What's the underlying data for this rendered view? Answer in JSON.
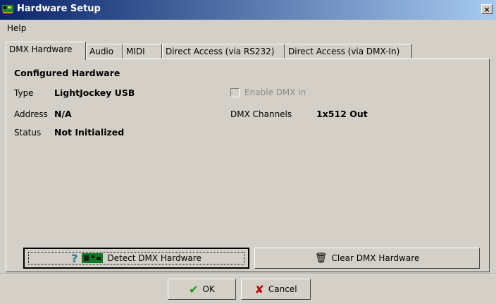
{
  "window": {
    "title": "Hardware Setup",
    "close_glyph": "×"
  },
  "menu": {
    "help": "Help"
  },
  "tabs": [
    {
      "label": "DMX Hardware",
      "active": true
    },
    {
      "label": "Audio"
    },
    {
      "label": "MIDI"
    },
    {
      "label": "Direct Access (via RS232)"
    },
    {
      "label": "Direct Access (via DMX-In)"
    }
  ],
  "configured": {
    "title": "Configured Hardware",
    "type_label": "Type",
    "type_value": "LightJockey USB",
    "address_label": "Address",
    "address_value": "N/A",
    "status_label": "Status",
    "status_value": "Not Initialized",
    "enable_dmx_label": "Enable DMX in",
    "enable_dmx_checked": false,
    "dmx_channels_label": "DMX Channels",
    "dmx_channels_value": "1x512 Out"
  },
  "buttons": {
    "detect": "Detect DMX Hardware",
    "clear": "Clear DMX Hardware",
    "ok": "OK",
    "cancel": "Cancel"
  },
  "icons": {
    "app": "hardware-card-icon",
    "detect_help": "question-icon",
    "detect_chip": "chip-icon",
    "clear": "trash-icon",
    "ok": "checkmark-icon",
    "cancel": "x-icon"
  },
  "colors": {
    "titlebar_start": "#0a246a",
    "titlebar_end": "#a6caf0",
    "face": "#d4d0c8",
    "disabled_text": "#8a8a8a",
    "ok_green": "#1a9a1a",
    "cancel_red": "#c00000"
  }
}
